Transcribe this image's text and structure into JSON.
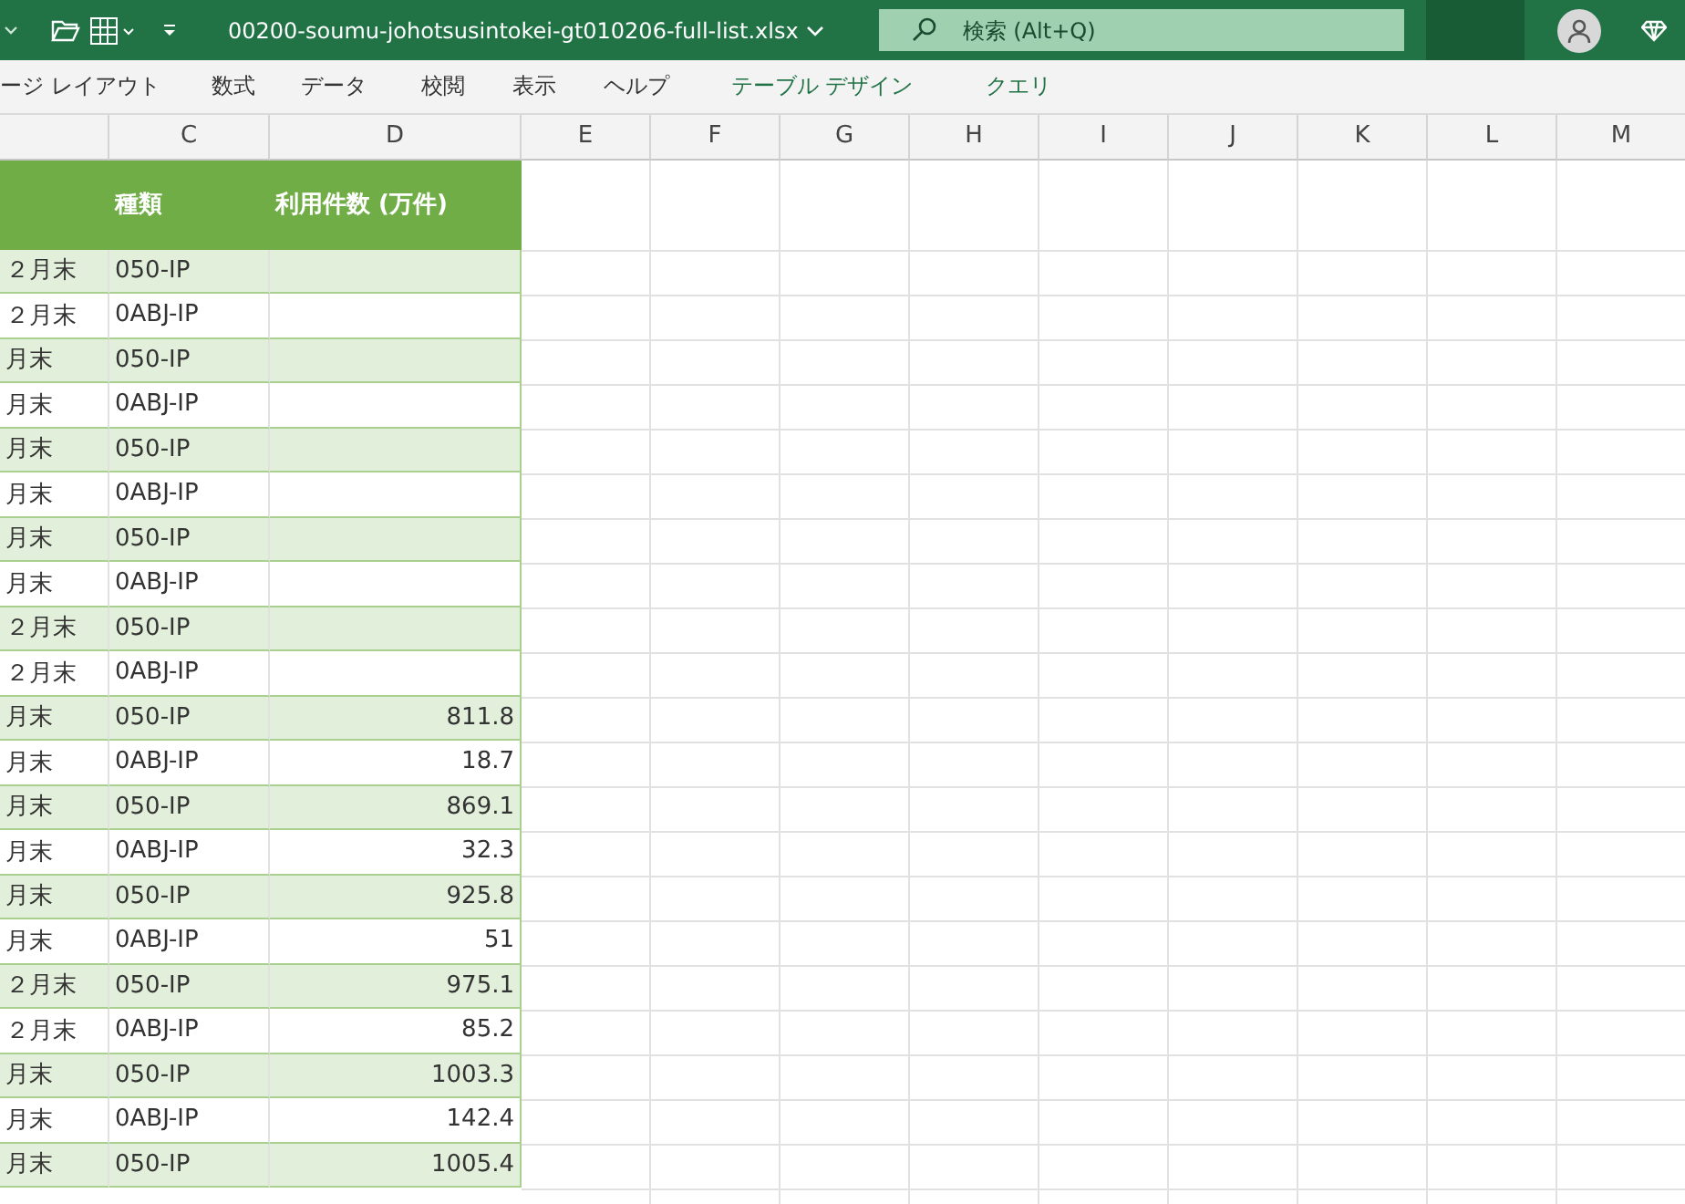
{
  "title_bar": {
    "file_name": "00200-soumu-johotsusintokei-gt010206-full-list.xlsx",
    "search": {
      "placeholder": "検索 (Alt+Q)"
    }
  },
  "ribbon_tabs": [
    {
      "label": "ージ レイアウト",
      "kind": "normal"
    },
    {
      "label": "数式",
      "kind": "normal"
    },
    {
      "label": "データ",
      "kind": "normal"
    },
    {
      "label": "校閲",
      "kind": "normal"
    },
    {
      "label": "表示",
      "kind": "normal"
    },
    {
      "label": "ヘルプ",
      "kind": "normal"
    },
    {
      "label": "テーブル デザイン",
      "kind": "contextual"
    },
    {
      "label": "クエリ",
      "kind": "contextual"
    }
  ],
  "column_headers": [
    "C",
    "D",
    "E",
    "F",
    "G",
    "H",
    "I",
    "J",
    "K",
    "L",
    "M"
  ],
  "table": {
    "headers": [
      "種類",
      "利用件数 (万件)"
    ],
    "rows": [
      {
        "column_b": "２月末",
        "type": "050-IP",
        "count": ""
      },
      {
        "column_b": "２月末",
        "type": "0ABJ-IP",
        "count": ""
      },
      {
        "column_b": "月末",
        "type": "050-IP",
        "count": ""
      },
      {
        "column_b": "月末",
        "type": "0ABJ-IP",
        "count": ""
      },
      {
        "column_b": "月末",
        "type": "050-IP",
        "count": ""
      },
      {
        "column_b": "月末",
        "type": "0ABJ-IP",
        "count": ""
      },
      {
        "column_b": "月末",
        "type": "050-IP",
        "count": ""
      },
      {
        "column_b": "月末",
        "type": "0ABJ-IP",
        "count": ""
      },
      {
        "column_b": "２月末",
        "type": "050-IP",
        "count": ""
      },
      {
        "column_b": "２月末",
        "type": "0ABJ-IP",
        "count": ""
      },
      {
        "column_b": "月末",
        "type": "050-IP",
        "count": "811.8"
      },
      {
        "column_b": "月末",
        "type": "0ABJ-IP",
        "count": "18.7"
      },
      {
        "column_b": "月末",
        "type": "050-IP",
        "count": "869.1"
      },
      {
        "column_b": "月末",
        "type": "0ABJ-IP",
        "count": "32.3"
      },
      {
        "column_b": "月末",
        "type": "050-IP",
        "count": "925.8"
      },
      {
        "column_b": "月末",
        "type": "0ABJ-IP",
        "count": "51"
      },
      {
        "column_b": "２月末",
        "type": "050-IP",
        "count": "975.1"
      },
      {
        "column_b": "２月末",
        "type": "0ABJ-IP",
        "count": "85.2"
      },
      {
        "column_b": "月末",
        "type": "050-IP",
        "count": "1003.3"
      },
      {
        "column_b": "月末",
        "type": "0ABJ-IP",
        "count": "142.4"
      },
      {
        "column_b": "月末",
        "type": "050-IP",
        "count": "1005.4"
      }
    ]
  }
}
